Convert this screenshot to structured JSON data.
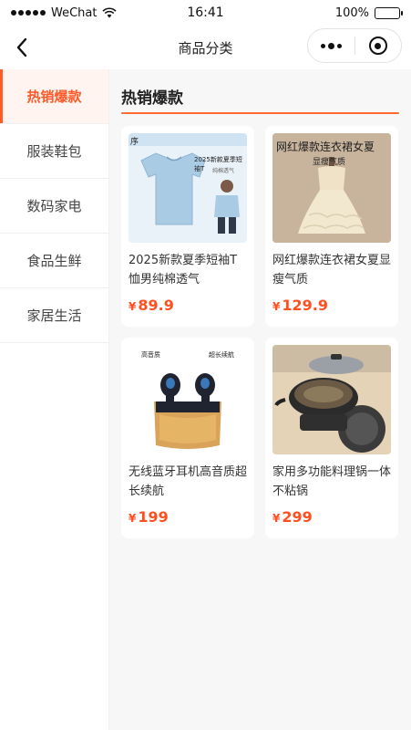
{
  "status_bar": {
    "carrier": "WeChat",
    "time": "16:41",
    "battery": "100%",
    "battery_level": 1.0
  },
  "nav": {
    "title": "商品分类"
  },
  "sidebar": {
    "items": [
      {
        "label": "热销爆款",
        "active": true
      },
      {
        "label": "服装鞋包",
        "active": false
      },
      {
        "label": "数码家电",
        "active": false
      },
      {
        "label": "食品生鲜",
        "active": false
      },
      {
        "label": "家居生活",
        "active": false
      }
    ]
  },
  "main": {
    "section_title": "热销爆款",
    "products": [
      {
        "name": "2025新款夏季短袖T恤男纯棉透气",
        "currency": "¥",
        "price": "89.9",
        "image_icon": "tshirt-image",
        "image_text": [
          "序",
          "2025新款夏季短袖T",
          "纯棉透气"
        ]
      },
      {
        "name": "网红爆款连衣裙女夏显瘦气质",
        "currency": "¥",
        "price": "129.9",
        "image_icon": "dress-image",
        "image_text": [
          "网红爆款连衣裙女夏",
          "显瘦气质"
        ]
      },
      {
        "name": "无线蓝牙耳机高音质超长续航",
        "currency": "¥",
        "price": "199",
        "image_icon": "earbuds-image",
        "image_text": [
          "高音质",
          "超长续航"
        ]
      },
      {
        "name": "家用多功能料理锅一体不粘锅",
        "currency": "¥",
        "price": "299",
        "image_icon": "cooking-pot-image",
        "image_text": []
      }
    ]
  },
  "colors": {
    "accent": "#ff5a2a",
    "price": "#ff4e1f",
    "active_bg": "#fff4ef"
  }
}
